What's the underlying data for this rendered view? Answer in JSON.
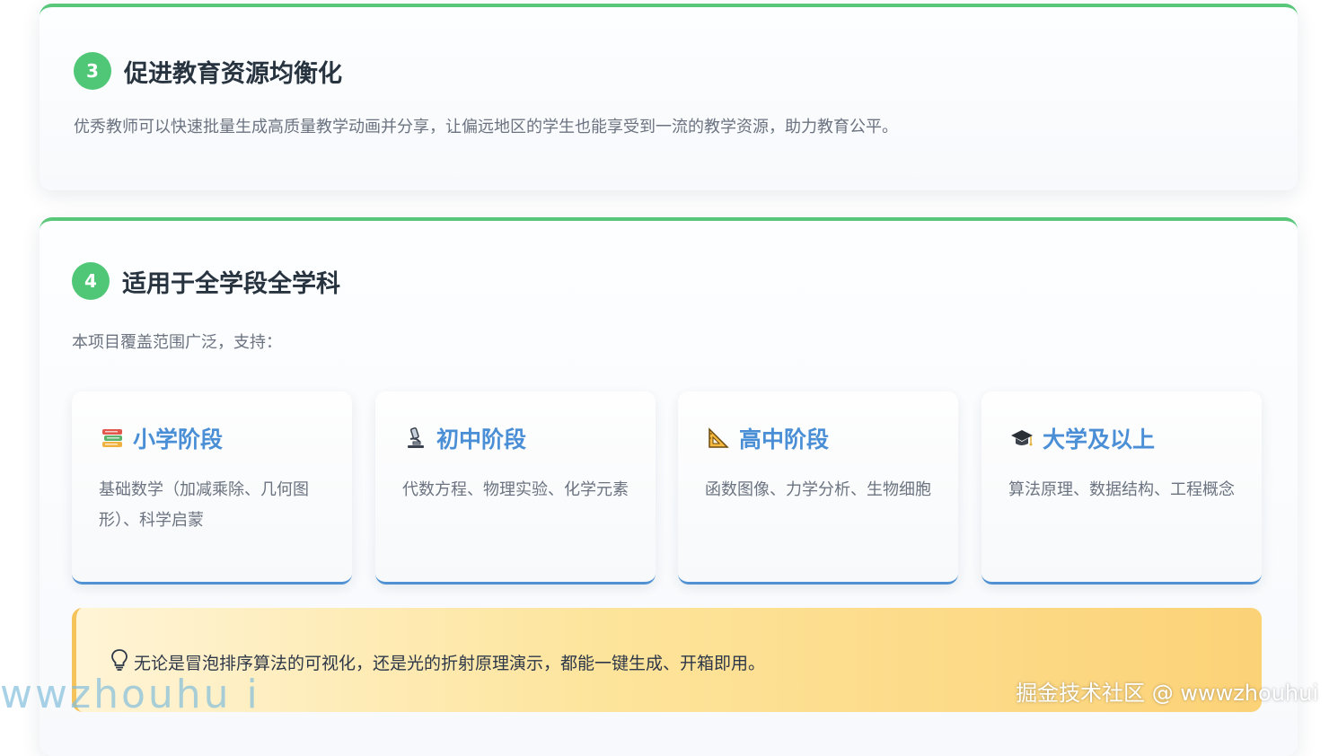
{
  "section3": {
    "number": "3",
    "title": "促进教育资源均衡化",
    "description": "优秀教师可以快速批量生成高质量教学动画并分享，让偏远地区的学生也能享受到一流的教学资源，助力教育公平。"
  },
  "section4": {
    "number": "4",
    "title": "适用于全学段全学科",
    "description": "本项目覆盖范围广泛，支持：",
    "levels": [
      {
        "icon": "books-icon",
        "title": "小学阶段",
        "description": "基础数学（加减乘除、几何图形）、科学启蒙"
      },
      {
        "icon": "microscope-icon",
        "title": "初中阶段",
        "description": "代数方程、物理实验、化学元素"
      },
      {
        "icon": "triangle-ruler-icon",
        "title": "高中阶段",
        "description": "函数图像、力学分析、生物细胞"
      },
      {
        "icon": "graduation-cap-icon",
        "title": "大学及以上",
        "description": "算法原理、数据结构、工程概念"
      }
    ],
    "tip": {
      "icon": "lightbulb-icon",
      "text": "无论是冒泡排序算法的可视化，还是光的折射原理演示，都能一键生成、开箱即用。"
    }
  },
  "watermark": {
    "left": "wwzhouhu i",
    "right": "掘金技术社区 @ wwwzhouhui"
  },
  "colors": {
    "accent_green": "#4fc776",
    "card_border_blue": "#4f91d3",
    "level_title_blue": "#4a8fd6",
    "tip_gradient_start": "#fff4d6",
    "tip_gradient_end": "#fcd277"
  }
}
